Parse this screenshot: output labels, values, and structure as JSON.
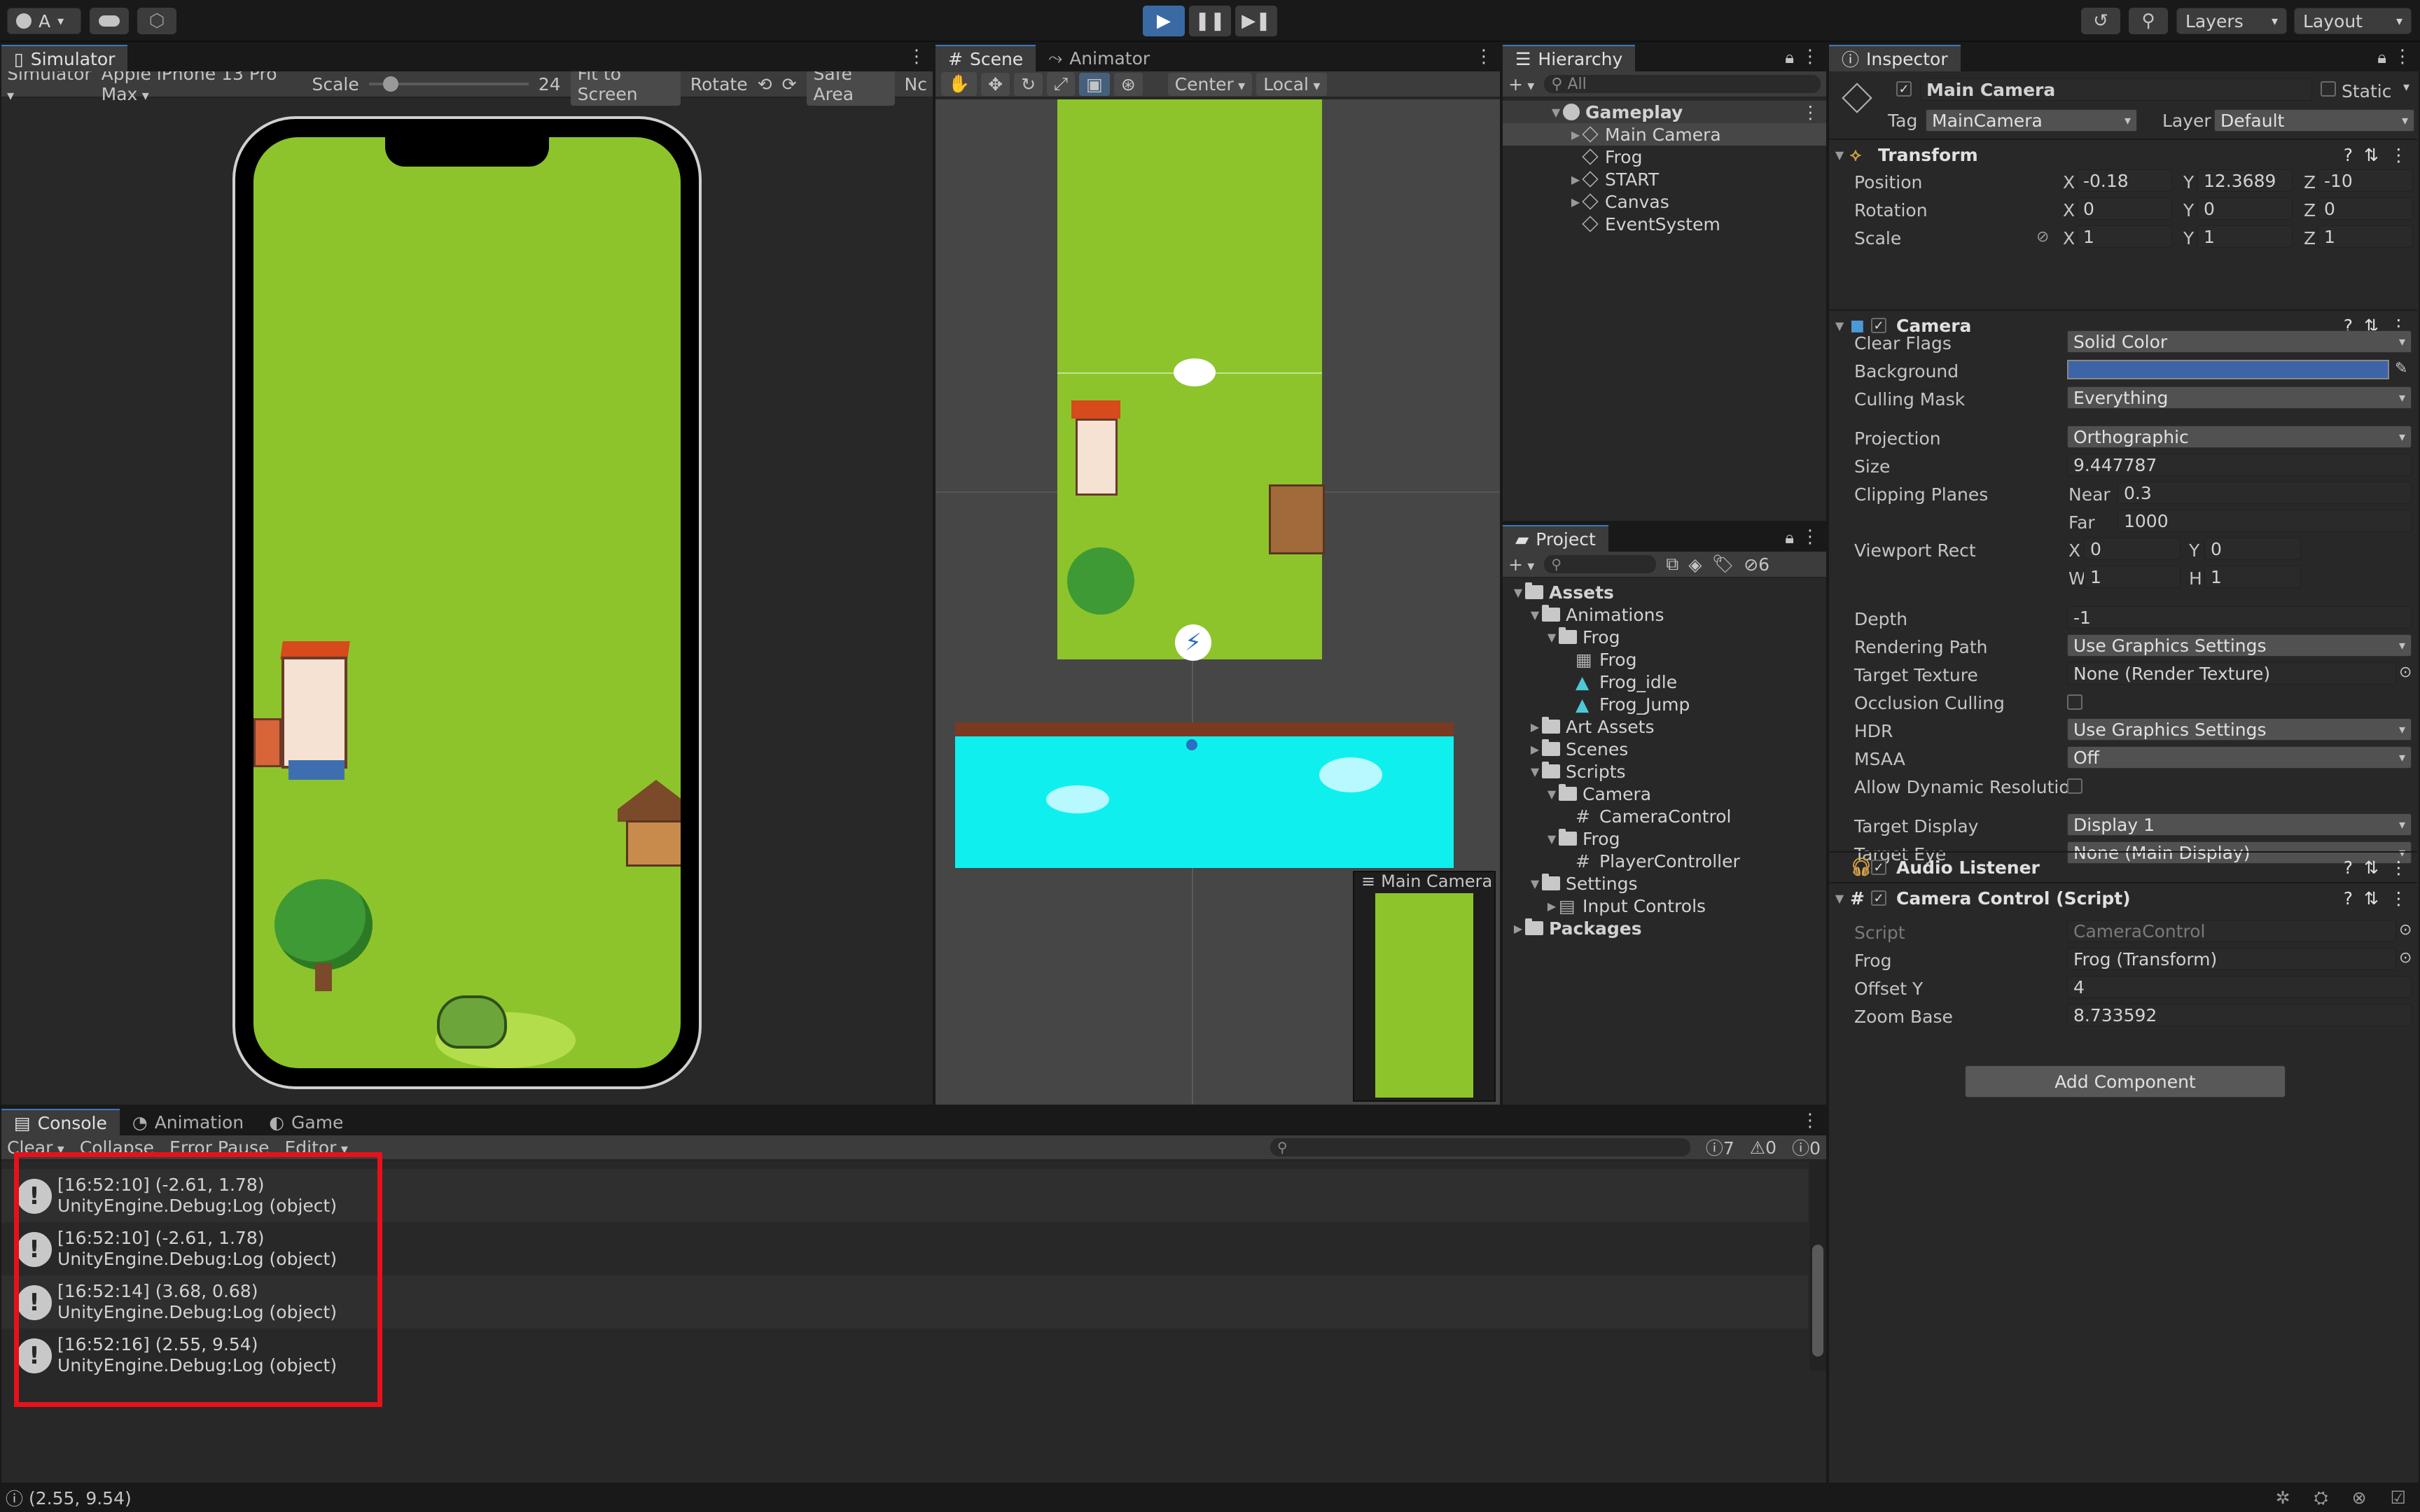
{
  "toolbar": {
    "account": "A",
    "layers": "Layers",
    "layout": "Layout"
  },
  "simulator": {
    "tab": "Simulator",
    "mode": "Simulator",
    "device": "Apple iPhone 13 Pro Max",
    "scale_label": "Scale",
    "scale_value": "24",
    "fit": "Fit to Screen",
    "rotate": "Rotate",
    "safe_area": "Safe Area",
    "nc": "Nc"
  },
  "scene": {
    "tab_scene": "Scene",
    "tab_animator": "Animator",
    "pivot": "Center",
    "space": "Local",
    "cam_preview": "Main Camera"
  },
  "hierarchy": {
    "tab": "Hierarchy",
    "search_placeholder": "All",
    "scene_name": "Gameplay",
    "items": [
      "Main Camera",
      "Frog",
      "START",
      "Canvas",
      "EventSystem"
    ]
  },
  "project": {
    "tab": "Project",
    "count": "6",
    "tree": [
      {
        "label": "Assets",
        "level": 0,
        "open": true,
        "type": "folder",
        "bold": true
      },
      {
        "label": "Animations",
        "level": 1,
        "open": true,
        "type": "folder"
      },
      {
        "label": "Frog",
        "level": 2,
        "open": true,
        "type": "folder"
      },
      {
        "label": "Frog",
        "level": 3,
        "type": "anim"
      },
      {
        "label": "Frog_idle",
        "level": 3,
        "type": "clip"
      },
      {
        "label": "Frog_Jump",
        "level": 3,
        "type": "clip"
      },
      {
        "label": "Art Assets",
        "level": 1,
        "open": false,
        "type": "folder"
      },
      {
        "label": "Scenes",
        "level": 1,
        "open": false,
        "type": "folder"
      },
      {
        "label": "Scripts",
        "level": 1,
        "open": true,
        "type": "folder"
      },
      {
        "label": "Camera",
        "level": 2,
        "open": true,
        "type": "folder"
      },
      {
        "label": "CameraControl",
        "level": 3,
        "type": "script"
      },
      {
        "label": "Frog",
        "level": 2,
        "open": true,
        "type": "folder"
      },
      {
        "label": "PlayerController",
        "level": 3,
        "type": "script"
      },
      {
        "label": "Settings",
        "level": 1,
        "open": true,
        "type": "folder"
      },
      {
        "label": "Input Controls",
        "level": 2,
        "open": false,
        "type": "input"
      },
      {
        "label": "Packages",
        "level": 0,
        "open": false,
        "type": "folder",
        "bold": true
      }
    ]
  },
  "inspector": {
    "tab": "Inspector",
    "object_name": "Main Camera",
    "static": "Static",
    "tag_label": "Tag",
    "tag": "MainCamera",
    "layer_label": "Layer",
    "layer": "Default",
    "transform": {
      "title": "Transform",
      "position_label": "Position",
      "rotation_label": "Rotation",
      "scale_label": "Scale",
      "position": [
        "-0.18",
        "12.3689",
        "-10"
      ],
      "rotation": [
        "0",
        "0",
        "0"
      ],
      "scale": [
        "1",
        "1",
        "1"
      ]
    },
    "axes": [
      "X",
      "Y",
      "Z"
    ],
    "camera": {
      "title": "Camera",
      "rows": [
        {
          "label": "Clear Flags",
          "value": "Solid Color",
          "kind": "dropdown"
        },
        {
          "label": "Background",
          "value": "",
          "kind": "color"
        },
        {
          "label": "Culling Mask",
          "value": "Everything",
          "kind": "dropdown"
        },
        {
          "label": "Projection",
          "value": "Orthographic",
          "kind": "dropdown"
        },
        {
          "label": "Size",
          "value": "9.447787",
          "kind": "field"
        },
        {
          "label": "Clipping Planes",
          "value": "",
          "kind": "label"
        },
        {
          "label": "Viewport Rect",
          "value": "",
          "kind": "label"
        },
        {
          "label": "Depth",
          "value": "-1",
          "kind": "field"
        },
        {
          "label": "Rendering Path",
          "value": "Use Graphics Settings",
          "kind": "dropdown"
        },
        {
          "label": "Target Texture",
          "value": "None (Render Texture)",
          "kind": "object"
        },
        {
          "label": "Occlusion Culling",
          "value": "",
          "kind": "check"
        },
        {
          "label": "HDR",
          "value": "Use Graphics Settings",
          "kind": "dropdown"
        },
        {
          "label": "MSAA",
          "value": "Off",
          "kind": "dropdown"
        },
        {
          "label": "Allow Dynamic Resolution",
          "value": "",
          "kind": "check"
        },
        {
          "label": "Target Display",
          "value": "Display 1",
          "kind": "dropdown"
        },
        {
          "label": "Target Eye",
          "value": "None (Main Display)",
          "kind": "dropdown"
        }
      ],
      "near_label": "Near",
      "near": "0.3",
      "far_label": "Far",
      "far": "1000",
      "vp": {
        "x": "0",
        "y": "0",
        "w": "1",
        "h": "1"
      },
      "vp_labels": {
        "x": "X",
        "y": "Y",
        "w": "W",
        "h": "H"
      },
      "bg_color": "#3e64a8"
    },
    "audio": {
      "title": "Audio Listener"
    },
    "camctl": {
      "title": "Camera Control (Script)",
      "rows": [
        {
          "label": "Script",
          "value": "CameraControl"
        },
        {
          "label": "Frog",
          "value": "Frog (Transform)"
        },
        {
          "label": "Offset Y",
          "value": "4"
        },
        {
          "label": "Zoom Base",
          "value": "8.733592"
        }
      ]
    },
    "add_component": "Add Component"
  },
  "console": {
    "tabs": [
      "Console",
      "Animation",
      "Game"
    ],
    "clear": "Clear",
    "collapse": "Collapse",
    "error_pause": "Error Pause",
    "editor": "Editor",
    "counts": {
      "log": "7",
      "warn": "0",
      "error": "0"
    },
    "entries": [
      {
        "line1": "[16:52:10] (-2.61, 1.78)",
        "line2": "UnityEngine.Debug:Log (object)"
      },
      {
        "line1": "[16:52:10] (-2.61, 1.78)",
        "line2": "UnityEngine.Debug:Log (object)"
      },
      {
        "line1": "[16:52:14] (3.68, 0.68)",
        "line2": "UnityEngine.Debug:Log (object)"
      },
      {
        "line1": "[16:52:16] (2.55, 9.54)",
        "line2": "UnityEngine.Debug:Log (object)"
      }
    ],
    "highlight_color": "#e8101a"
  },
  "status": {
    "text": "(2.55, 9.54)"
  },
  "colors": {
    "grass": "#8dc42b",
    "water": "#0ff0ee",
    "accent": "#3a79bb"
  }
}
